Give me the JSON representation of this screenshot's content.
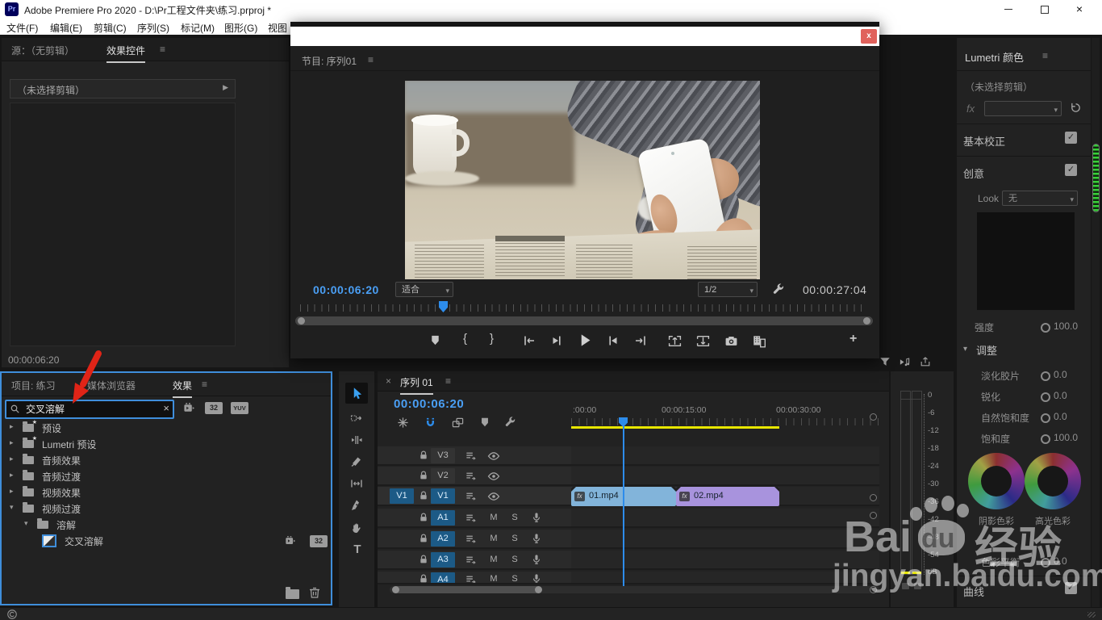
{
  "window": {
    "app_badge": "Pr",
    "title": "Adobe Premiere Pro 2020 - D:\\Pr工程文件夹\\练习.prproj *",
    "close_glyph": "×"
  },
  "menu": {
    "items": [
      "文件(F)",
      "编辑(E)",
      "剪辑(C)",
      "序列(S)",
      "标记(M)",
      "图形(G)",
      "视图"
    ]
  },
  "source_panel": {
    "tab_source": "源：（无剪辑）",
    "tab_effect_controls": "效果控件",
    "menu_icon": "≡",
    "no_clip": "（未选择剪辑）",
    "expand_arrow": "▶",
    "timecode": "00:00:06:20"
  },
  "program": {
    "close": "x",
    "title": "节目: 序列01",
    "menu_icon": "≡",
    "timecode": "00:00:06:20",
    "fit": "适合",
    "resolution": "1/2",
    "duration": "00:00:27:04",
    "mark_in": "{",
    "mark_out": "}",
    "add": "+",
    "chevron": "▾"
  },
  "project_panel": {
    "tab_project": "项目: 练习",
    "tab_media": "媒体浏览器",
    "tab_effects": "效果",
    "menu_icon": "≡",
    "search_value": "交叉溶解",
    "clear": "×",
    "badge_32": "32",
    "badge_yuv": "YUV",
    "tree": [
      {
        "label": "预设"
      },
      {
        "label": "Lumetri 预设"
      },
      {
        "label": "音频效果"
      },
      {
        "label": "音频过渡"
      },
      {
        "label": "视频效果"
      },
      {
        "label": "视频过渡"
      },
      {
        "label": "溶解"
      },
      {
        "label": "交叉溶解"
      }
    ],
    "collapsed": "▸",
    "expanded": "▾"
  },
  "timeline": {
    "close": "×",
    "tab": "序列 01",
    "menu_icon": "≡",
    "timecode": "00:00:06:20",
    "ruler": [
      ":00:00",
      "00:00:15:00",
      "00:00:30:00"
    ],
    "tracks_video": [
      "V3",
      "V2",
      "V1"
    ],
    "source_patch": "V1",
    "tracks_audio": [
      "A1",
      "A2",
      "A3",
      "A4"
    ],
    "mute": "M",
    "solo": "S",
    "clips": [
      {
        "name": "01.mp4",
        "fx": "fx"
      },
      {
        "name": "02.mp4",
        "fx": "fx"
      }
    ]
  },
  "meters": {
    "ticks": [
      "0",
      "-6",
      "-12",
      "-18",
      "-24",
      "-30",
      "-36",
      "-42",
      "-48",
      "-54"
    ],
    "unit": "dB"
  },
  "lumetri": {
    "title": "Lumetri 颜色",
    "menu_icon": "≡",
    "no_clip": "（未选择剪辑）",
    "fx": "fx",
    "basic": "基本校正",
    "creative": "创意",
    "look": "Look",
    "look_value": "无",
    "intensity": "强度",
    "intensity_value": "100.0",
    "adjust": "调整",
    "adjust_twisty": "▾",
    "rows": [
      {
        "label": "淡化胶片",
        "value": "0.0"
      },
      {
        "label": "锐化",
        "value": "0.0"
      },
      {
        "label": "自然饱和度",
        "value": "0.0"
      },
      {
        "label": "饱和度",
        "value": "100.0"
      }
    ],
    "wheel_shadow": "阴影色彩",
    "wheel_highlight": "高光色彩",
    "balance": "色彩平衡",
    "balance_value": "0.0",
    "curves": "曲线",
    "check": "✓",
    "chevron": "▾"
  },
  "watermark": {
    "bai": "Bai",
    "du": "du",
    "brand": "经验",
    "url": "jingyan.baidu.com"
  },
  "colors": {
    "accent_blue": "#3f8edb",
    "timecode_blue": "#4a9ff5",
    "clip_blue": "#82b4da",
    "clip_purple": "#a893dd",
    "work_area_yellow": "#e8e600",
    "close_red": "#e0625c",
    "arrow_red": "#e02417",
    "meter_green": "#38d038",
    "track_blue": "#1c5a86"
  }
}
